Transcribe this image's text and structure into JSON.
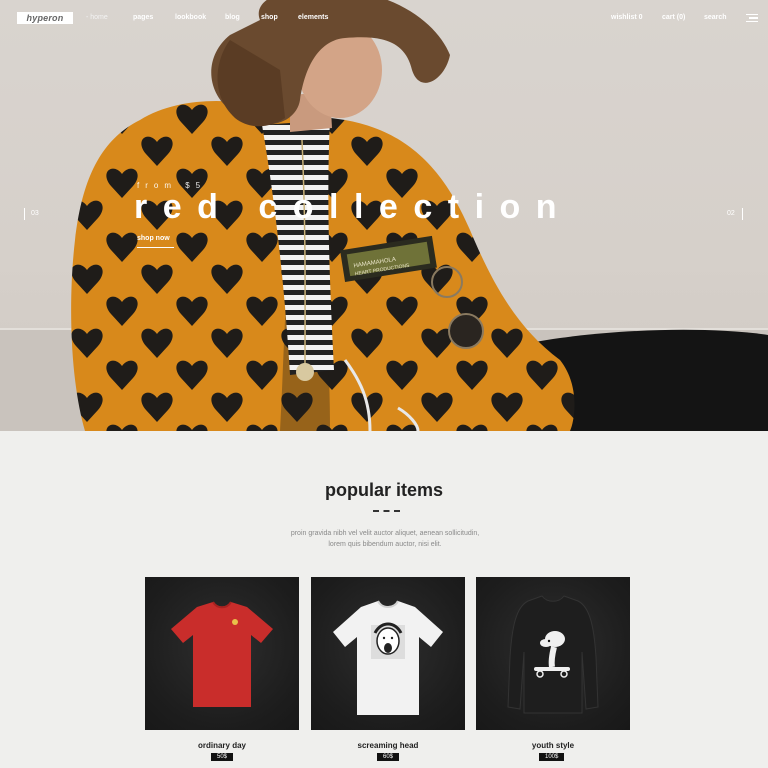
{
  "brand": {
    "logo_text": "hyperon"
  },
  "nav": {
    "home": "- home",
    "pages": "pages",
    "lookbook": "lookbook",
    "blog": "blog",
    "shop": "shop",
    "elements": "elements",
    "wishlist": "wishlist 0",
    "cart": "cart (0)",
    "search": "search"
  },
  "hero": {
    "pre_title": "from $5",
    "title": "red collection",
    "cta": "shop now",
    "prev_index": "03",
    "next_index": "02",
    "patch_line1": "HAMAMAHOLA",
    "patch_line2": "HEART PRODUCTIONS"
  },
  "popular": {
    "title": "popular items",
    "description_line1": "proin gravida nibh vel velit auctor aliquet, aenean sollicitudin,",
    "description_line2": "lorem quis bibendum auctor, nisi elit.",
    "products": [
      {
        "name": "ordinary day",
        "price": "50$",
        "shirt_color": "#c92d2b"
      },
      {
        "name": "screaming head",
        "price": "60$",
        "shirt_color": "#f2f2f2"
      },
      {
        "name": "youth style",
        "price": "100$",
        "shirt_color": "#1e1e1e"
      }
    ]
  },
  "colors": {
    "jacket_orange": "#d8891b",
    "jacket_dark": "#1f1c19",
    "background": "#efefed"
  }
}
